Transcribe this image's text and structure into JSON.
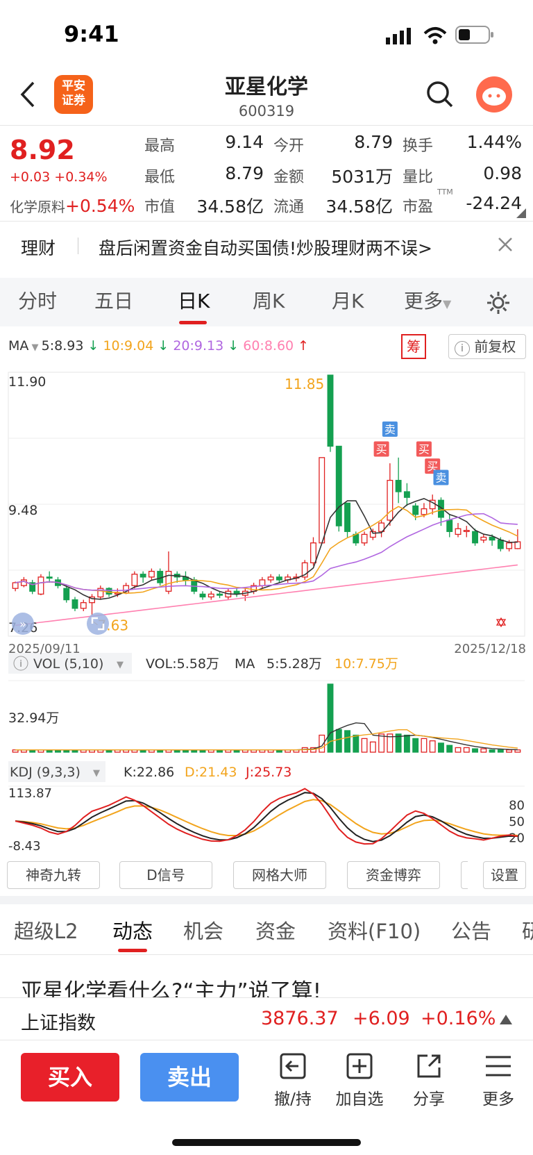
{
  "status": {
    "time": "9:41"
  },
  "header": {
    "title": "亚星化学",
    "code": "600319",
    "logo_line1": "平安",
    "logo_line2": "证券"
  },
  "quote": {
    "price": "8.92",
    "change": "+0.03",
    "change_pct": "+0.34%",
    "sector_name": "化学原料",
    "sector_pct": "+0.54%",
    "high_label": "最高",
    "high": "9.14",
    "open_label": "今开",
    "open": "8.79",
    "turnover_label": "换手",
    "turnover": "1.44%",
    "low_label": "最低",
    "low": "8.79",
    "amount_label": "金额",
    "amount": "5031万",
    "volratio_label": "量比",
    "volratio": "0.98",
    "mcap_label": "市值",
    "mcap": "34.58亿",
    "float_label": "流通",
    "float": "34.58亿",
    "pe_label": "市盈",
    "pe_sup": "TTM",
    "pe": "-24.24"
  },
  "banner": {
    "tag": "理财",
    "text": "盘后闲置资金自动买国债!炒股理财两不误>"
  },
  "chart_tabs": [
    "分时",
    "五日",
    "日K",
    "周K",
    "月K",
    "更多"
  ],
  "ma_legend": {
    "ma": "MA",
    "ma5": "5:8.93",
    "ma10": "10:9.04",
    "ma20": "20:9.13",
    "ma60": "60:8.60",
    "chou": "筹",
    "fq": "前复权",
    "c_ma5": "#333333",
    "c_ma10": "#f2a41c",
    "c_ma20": "#b066e0",
    "c_ma60": "#ff80b0"
  },
  "chart_data": {
    "type": "candlestick",
    "y_top_label": "11.90",
    "y_mid_label": "9.48",
    "y_bottom_label": "7.26",
    "ylim": [
      7.26,
      11.9
    ],
    "max_label": "11.85",
    "min_label": "7.63",
    "start_date": "2025/09/11",
    "end_date": "2025/12/18",
    "signals": {
      "buy": "买",
      "sell": "卖"
    },
    "candles": [
      [
        8.1,
        8.2,
        8.05,
        8.22
      ],
      [
        8.15,
        8.25,
        8.12,
        8.3
      ],
      [
        8.2,
        8.05,
        8.0,
        8.25
      ],
      [
        8.0,
        8.3,
        7.98,
        8.35
      ],
      [
        8.3,
        8.28,
        8.2,
        8.4
      ],
      [
        8.25,
        8.15,
        8.1,
        8.3
      ],
      [
        8.1,
        7.9,
        7.85,
        8.15
      ],
      [
        7.9,
        7.75,
        7.7,
        7.95
      ],
      [
        7.75,
        7.85,
        7.7,
        7.9
      ],
      [
        7.85,
        7.95,
        7.63,
        8.0
      ],
      [
        7.95,
        8.1,
        7.9,
        8.15
      ],
      [
        8.1,
        8.0,
        7.95,
        8.12
      ],
      [
        8.0,
        8.02,
        7.95,
        8.1
      ],
      [
        8.02,
        8.15,
        8.0,
        8.2
      ],
      [
        8.15,
        8.35,
        8.1,
        8.4
      ],
      [
        8.35,
        8.3,
        8.2,
        8.4
      ],
      [
        8.3,
        8.4,
        8.25,
        8.45
      ],
      [
        8.4,
        8.2,
        8.15,
        8.45
      ],
      [
        8.05,
        8.4,
        8.0,
        8.75
      ],
      [
        8.35,
        8.3,
        8.2,
        8.4
      ],
      [
        8.3,
        8.25,
        8.15,
        8.4
      ],
      [
        8.25,
        8.05,
        8.0,
        8.3
      ],
      [
        8.0,
        7.95,
        7.9,
        8.05
      ],
      [
        7.95,
        8.0,
        7.9,
        8.05
      ],
      [
        8.0,
        7.98,
        7.93,
        8.05
      ],
      [
        7.95,
        8.05,
        7.9,
        8.1
      ],
      [
        8.05,
        8.0,
        7.95,
        8.1
      ],
      [
        7.98,
        8.05,
        7.88,
        8.1
      ],
      [
        8.05,
        8.15,
        8.0,
        8.2
      ],
      [
        8.15,
        8.25,
        8.1,
        8.3
      ],
      [
        8.25,
        8.3,
        8.2,
        8.35
      ],
      [
        8.3,
        8.25,
        8.2,
        8.35
      ],
      [
        8.25,
        8.3,
        8.2,
        8.35
      ],
      [
        8.3,
        8.3,
        8.22,
        8.36
      ],
      [
        8.3,
        8.55,
        8.25,
        8.6
      ],
      [
        8.55,
        8.9,
        8.5,
        9.0
      ],
      [
        8.9,
        10.4,
        8.9,
        10.4
      ],
      [
        11.85,
        10.6,
        10.5,
        11.85
      ],
      [
        10.6,
        9.2,
        9.1,
        9.8
      ],
      [
        9.6,
        9.1,
        9.0,
        9.2
      ],
      [
        9.05,
        8.9,
        8.85,
        9.1
      ],
      [
        8.9,
        9.05,
        8.85,
        9.1
      ],
      [
        9.0,
        9.1,
        8.95,
        9.15
      ],
      [
        9.1,
        9.25,
        9.0,
        9.3
      ],
      [
        9.3,
        10.0,
        9.2,
        10.3
      ],
      [
        10.0,
        9.8,
        9.6,
        10.4
      ],
      [
        9.8,
        9.7,
        9.55,
        9.95
      ],
      [
        9.55,
        9.4,
        9.3,
        9.6
      ],
      [
        9.4,
        9.5,
        9.35,
        9.6
      ],
      [
        9.5,
        9.65,
        9.4,
        9.75
      ],
      [
        9.65,
        9.35,
        9.2,
        9.7
      ],
      [
        9.3,
        9.1,
        9.0,
        9.4
      ],
      [
        9.05,
        9.15,
        9.0,
        9.25
      ],
      [
        9.1,
        9.12,
        9.0,
        9.2
      ],
      [
        9.1,
        8.9,
        8.85,
        9.15
      ],
      [
        8.95,
        9.0,
        8.9,
        9.05
      ],
      [
        9.0,
        8.95,
        8.85,
        9.05
      ],
      [
        8.95,
        8.8,
        8.75,
        9.0
      ],
      [
        8.8,
        8.9,
        8.75,
        8.95
      ],
      [
        8.8,
        8.92,
        8.79,
        9.14
      ]
    ],
    "vol": {
      "label": "VOL (5,10)",
      "vol_text": "VOL:5.58万",
      "ma_text": "MA",
      "ma5_text": "5:5.28万",
      "ma10_text": "10:7.75万",
      "y_label": "32.94万",
      "values": [
        2,
        2,
        2,
        2,
        2,
        2,
        2,
        2,
        2,
        2,
        2,
        2,
        2,
        2,
        2,
        2,
        2,
        2,
        2,
        2,
        2,
        2,
        2,
        2,
        2,
        2,
        2,
        2,
        2,
        2,
        2,
        2,
        2,
        2,
        4,
        4,
        15,
        60,
        20,
        19,
        15,
        12,
        9,
        16,
        16,
        16,
        15,
        12,
        12,
        10,
        8,
        6,
        4,
        4,
        3,
        3,
        2,
        2,
        2,
        2
      ]
    },
    "kdj": {
      "label": "KDJ (9,3,3)",
      "k_text": "K:22.86",
      "d_text": "D:21.43",
      "j_text": "J:25.73",
      "y_top": "113.87",
      "y_bottom": "-8.43",
      "levels": [
        "80",
        "50",
        "20"
      ]
    }
  },
  "indicator_buttons": [
    "神奇九转",
    "D信号",
    "网格大师",
    "资金博弈",
    "设置"
  ],
  "lower_tabs": [
    "超级L2",
    "动态",
    "机会",
    "资金",
    "资料(F10)",
    "公告",
    "研"
  ],
  "news_title": "亚星化学看什么?“主力”说了算!",
  "index_bar": {
    "name": "上证指数",
    "value": "3876.37",
    "change": "+6.09",
    "pct": "+0.16%"
  },
  "bottom": {
    "buy": "买入",
    "sell": "卖出",
    "tools": [
      "撤/持",
      "加自选",
      "分享",
      "更多"
    ]
  },
  "colors": {
    "up": "#e02020",
    "down": "#14a050",
    "buy_btn": "#e8202a",
    "sell_btn": "#4a90f0",
    "accent": "#f5621a"
  }
}
